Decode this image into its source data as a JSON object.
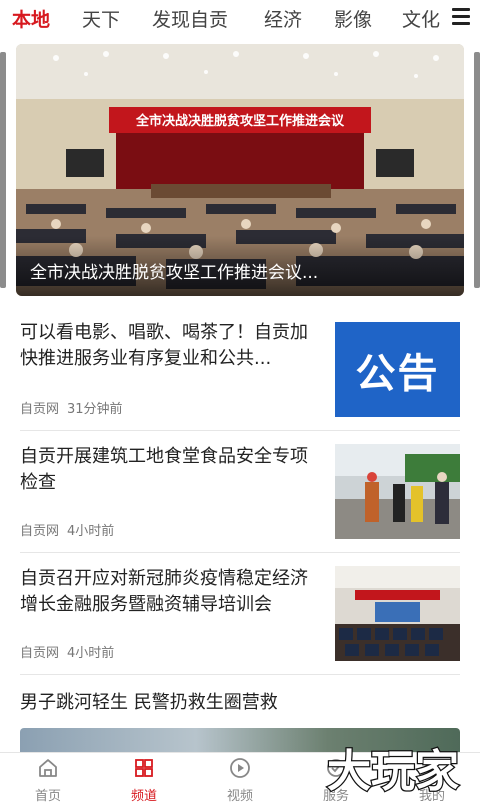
{
  "channels": {
    "active_index": 0,
    "items": [
      "本地",
      "天下",
      "发现自贡",
      "经济",
      "影像",
      "文化"
    ]
  },
  "hero": {
    "caption": "全市决战决胜脱贫攻坚工作推进会议...",
    "banner_text": "全市决战决胜脱贫攻坚工作推进会议"
  },
  "news": [
    {
      "title": "可以看电影、唱歌、喝茶了！自贡加快推进服务业有序复业和公共...",
      "source": "自贡网",
      "time": "31分钟前",
      "thumb": "公告"
    },
    {
      "title": "自贡开展建筑工地食堂食品安全专项检查",
      "source": "自贡网",
      "time": "4小时前"
    },
    {
      "title": "自贡召开应对新冠肺炎疫情稳定经济增长金融服务暨融资辅导培训会",
      "source": "自贡网",
      "time": "4小时前"
    }
  ],
  "partial_news": {
    "title": "男子跳河轻生 民警扔救生圈营救"
  },
  "bottom_nav": {
    "active_index": 1,
    "items": [
      {
        "label": "首页",
        "icon": "home-icon"
      },
      {
        "label": "频道",
        "icon": "grid-icon"
      },
      {
        "label": "视频",
        "icon": "play-icon"
      },
      {
        "label": "服务",
        "icon": "service-icon"
      },
      {
        "label": "我的",
        "icon": "user-icon"
      }
    ]
  },
  "watermark": "大玩家",
  "colors": {
    "accent": "#d7191f",
    "notice_blue": "#1f64c7"
  }
}
